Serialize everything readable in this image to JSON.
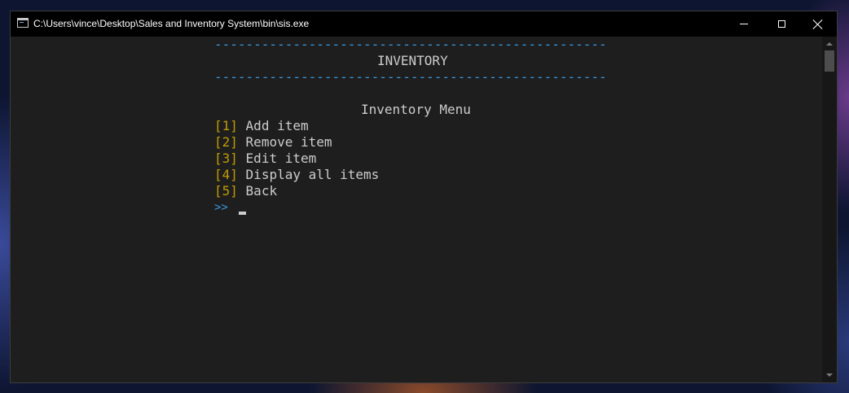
{
  "window": {
    "title": "C:\\Users\\vince\\Desktop\\Sales and Inventory System\\bin\\sis.exe"
  },
  "console": {
    "separator": "--------------------------------------------------",
    "header": "INVENTORY",
    "menu_title": "Inventory Menu",
    "menu_items": [
      {
        "key": "[1]",
        "label": "Add item"
      },
      {
        "key": "[2]",
        "label": "Remove item"
      },
      {
        "key": "[3]",
        "label": "Edit item"
      },
      {
        "key": "[4]",
        "label": "Display all items"
      },
      {
        "key": "[5]",
        "label": "Back"
      }
    ],
    "prompt": ">>"
  },
  "colors": {
    "console_background": "#1e1e1e",
    "text": "#cccccc",
    "separator": "#3a96dd",
    "menu_key": "#c19c00",
    "prompt": "#3a96dd",
    "titlebar": "#000000"
  }
}
